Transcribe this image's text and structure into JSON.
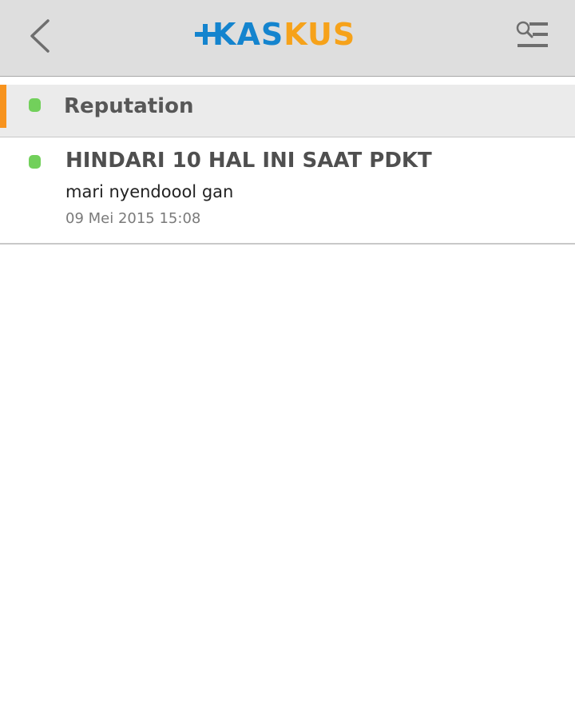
{
  "header": {
    "logo": {
      "part1": "KAS",
      "part2": "KUS"
    },
    "back_icon": "chevron-left-icon",
    "menu_icon": "search-menu-icon"
  },
  "section": {
    "title": "Reputation",
    "indicator_color": "#72d05b",
    "accent_color": "#f7931e"
  },
  "notifications": [
    {
      "title": "HINDARI 10 HAL INI SAAT PDKT",
      "body": "mari nyendoool gan",
      "time": "09 Mei 2015 15:08",
      "indicator_color": "#72d05b"
    }
  ],
  "colors": {
    "brand_blue": "#1484ce",
    "brand_orange": "#f6a21a",
    "topbar_bg": "#dedede"
  }
}
